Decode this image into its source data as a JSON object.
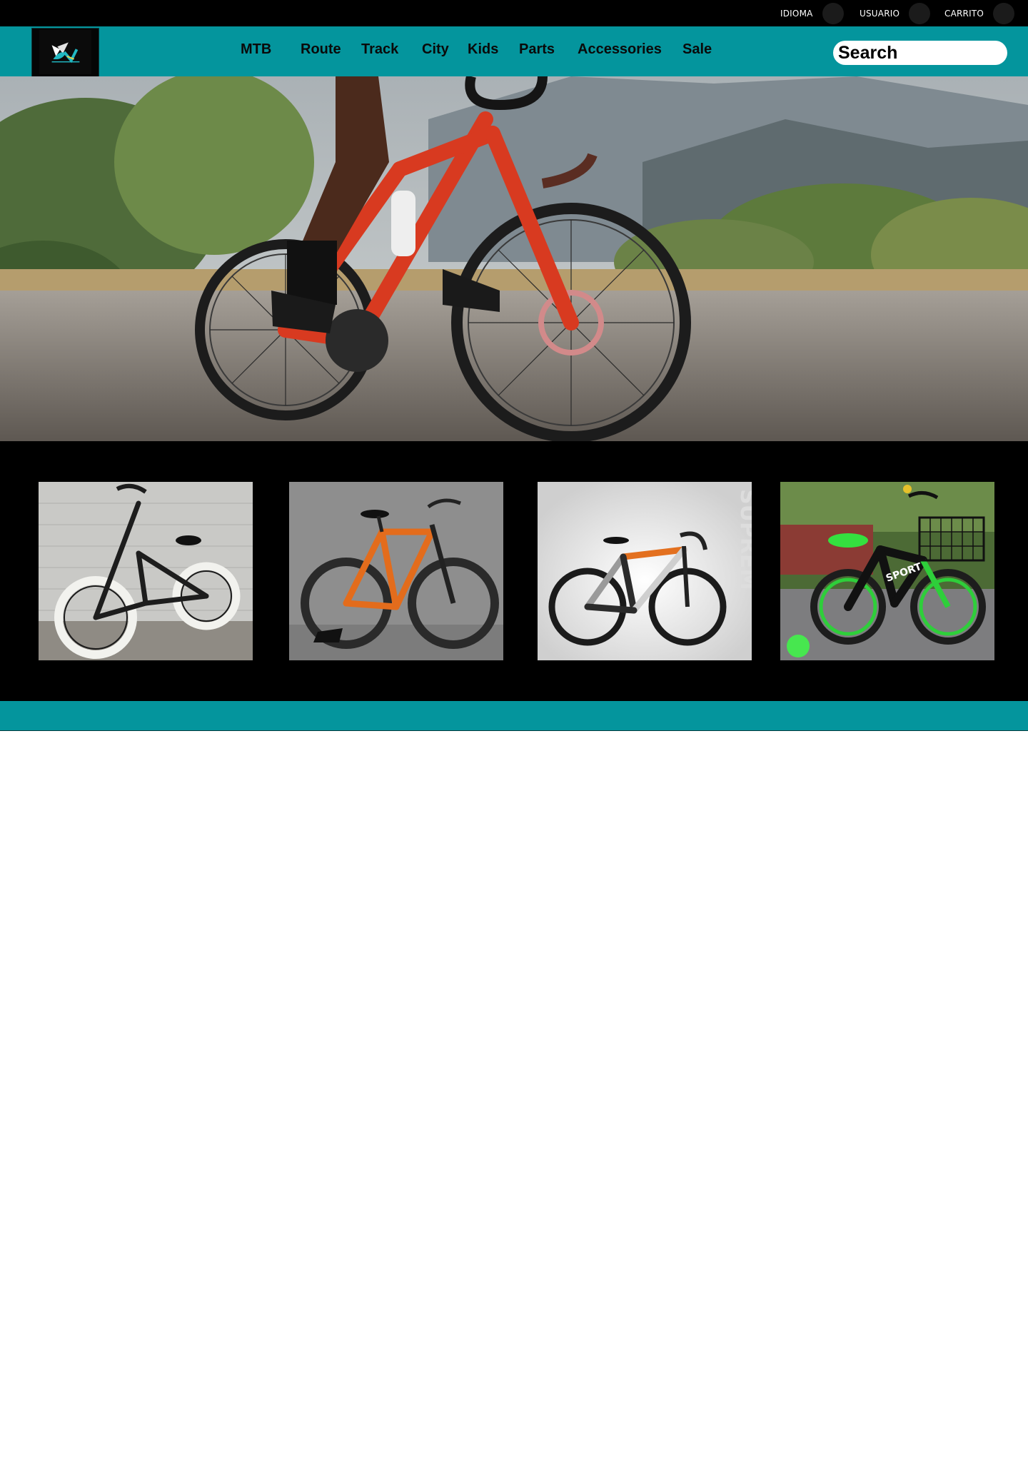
{
  "utility_bar": {
    "language_label": "IDIOMA",
    "user_label": "USUARIO",
    "cart_label": "CARRITO"
  },
  "header": {
    "nav": [
      {
        "label": "MTB"
      },
      {
        "label": "Route"
      },
      {
        "label": "Track"
      },
      {
        "label": "City"
      },
      {
        "label": "Kids"
      },
      {
        "label": "Parts"
      },
      {
        "label": "Accessories"
      },
      {
        "label": "Sale"
      }
    ],
    "search_placeholder": "Search"
  },
  "colors": {
    "brand_teal": "#04959d",
    "bar_black": "#000000"
  },
  "hero": {
    "image": "road-cyclist-red-bike-photo"
  },
  "products": [
    {
      "image": "bmx-bike-white-tires-photo"
    },
    {
      "image": "orange-mountain-bike-photo"
    },
    {
      "image": "carbon-road-bike-orange-accents-photo",
      "watermark": "SUPREM"
    },
    {
      "image": "kids-bike-green-with-basket-photo",
      "frame_text": "SPORT"
    }
  ]
}
